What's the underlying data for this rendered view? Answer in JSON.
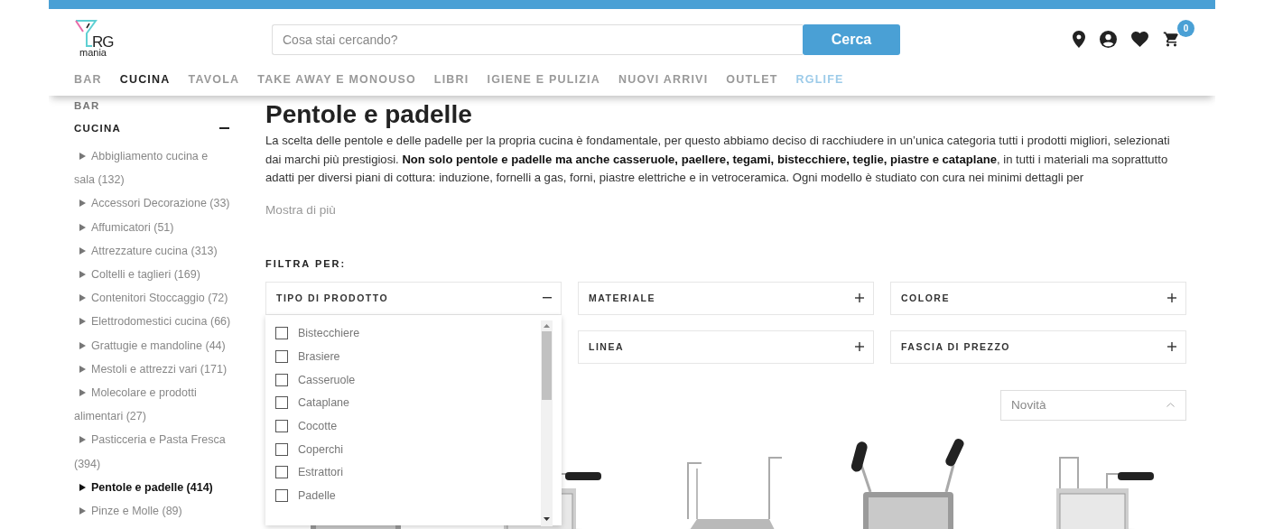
{
  "header": {
    "logo": {
      "text": "RG",
      "subtext": "mania"
    },
    "search": {
      "placeholder": "Cosa stai cercando?",
      "button": "Cerca"
    },
    "cart_count": "0"
  },
  "nav": [
    {
      "label": "BAR",
      "selected": false,
      "kind": "category"
    },
    {
      "label": "CUCINA",
      "selected": true,
      "kind": "category"
    },
    {
      "label": "TAVOLA",
      "selected": false,
      "kind": "category"
    },
    {
      "label": "TAKE AWAY E MONOUSO",
      "selected": false,
      "kind": "category"
    },
    {
      "label": "LIBRI",
      "selected": false,
      "kind": "category"
    },
    {
      "label": "IGIENE E PULIZIA",
      "selected": false,
      "kind": "category"
    },
    {
      "label": "NUOVI ARRIVI",
      "selected": false,
      "kind": "category"
    },
    {
      "label": "OUTLET",
      "selected": false,
      "kind": "category"
    },
    {
      "label": "RGLIFE",
      "selected": false,
      "kind": "promo"
    }
  ],
  "sidebar": {
    "items": [
      {
        "label": "BAR",
        "expanded": false
      },
      {
        "label": "CUCINA",
        "expanded": true,
        "children": [
          {
            "label": "Abbigliamento cucina e sala (132)",
            "selected": false
          },
          {
            "label": "Accessori Decorazione (33)",
            "selected": false
          },
          {
            "label": "Affumicatori (51)",
            "selected": false
          },
          {
            "label": "Attrezzature cucina (313)",
            "selected": false
          },
          {
            "label": "Coltelli e taglieri (169)",
            "selected": false
          },
          {
            "label": "Contenitori Stoccaggio (72)",
            "selected": false
          },
          {
            "label": "Elettrodomestici cucina (66)",
            "selected": false
          },
          {
            "label": "Grattugie e mandoline (44)",
            "selected": false
          },
          {
            "label": "Mestoli e attrezzi vari (171)",
            "selected": false
          },
          {
            "label": "Molecolare e prodotti alimentari (27)",
            "selected": false
          },
          {
            "label": "Pasticceria e Pasta Fresca (394)",
            "selected": false
          },
          {
            "label": "Pentole e padelle (414)",
            "selected": true
          },
          {
            "label": "Pinze e Molle (89)",
            "selected": false
          }
        ]
      }
    ]
  },
  "page": {
    "title": "Pentole e padelle",
    "description": "La scelta delle pentole e delle padelle per la propria cucina è fondamentale, per questo abbiamo deciso di racchiudere in un’unica categoria tutti i prodotti migliori, selezionati dai marchi più prestigiosi. **Non solo pentole e padelle ma anche casseruole, paellere, tegami, bistecchiere, teglie, piastre e cataplane**, in tutti i materiali ma soprattutto adatti per diversi piani di cottura: induzione, fornelli a gas, forni, piastre elettriche e in vetroceramica. Ogni modello è studiato con cura nei minimi dettagli per",
    "more_link": "Mostra di più"
  },
  "filters": {
    "label": "FILTRA PER:",
    "groups": [
      {
        "label": "TIPO DI PRODOTTO",
        "expanded": true,
        "options": [
          {
            "label": "Bistecchiere",
            "checked": false
          },
          {
            "label": "Brasiere",
            "checked": false
          },
          {
            "label": "Casseruole",
            "checked": false
          },
          {
            "label": "Cataplane",
            "checked": false
          },
          {
            "label": "Cocotte",
            "checked": false
          },
          {
            "label": "Coperchi",
            "checked": false
          },
          {
            "label": "Estrattori",
            "checked": false
          },
          {
            "label": "Padelle",
            "checked": false
          }
        ]
      },
      {
        "label": "MATERIALE",
        "expanded": false
      },
      {
        "label": "COLORE",
        "expanded": false
      },
      {
        "label": "LINEA",
        "expanded": false
      },
      {
        "label": "FASCIA DI PREZZO",
        "expanded": false
      }
    ]
  },
  "sort": {
    "value": "Novità"
  }
}
